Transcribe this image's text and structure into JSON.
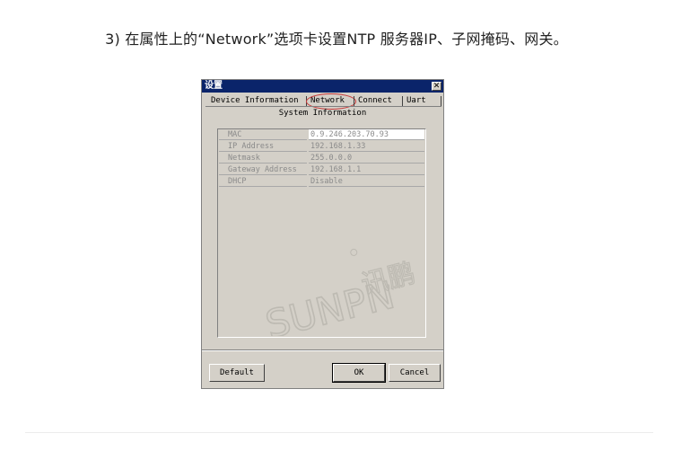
{
  "instruction": "3) 在属性上的“Network”选项卡设置NTP 服务器IP、子网掩码、网关。",
  "dialog": {
    "title": "设置",
    "close_label": "✕",
    "tabs": [
      {
        "label": "Device Information"
      },
      {
        "label": "Network"
      },
      {
        "label": "Connect"
      },
      {
        "label": "Uart"
      }
    ],
    "section_title": "System Information",
    "properties": [
      {
        "name": "MAC",
        "value": "0.9.246.203.70.93"
      },
      {
        "name": "IP Address",
        "value": "192.168.1.33"
      },
      {
        "name": "Netmask",
        "value": "255.0.0.0"
      },
      {
        "name": "Gateway Address",
        "value": "192.168.1.1"
      },
      {
        "name": "DHCP",
        "value": "Disable"
      }
    ],
    "watermark": {
      "latin": "SUNPN",
      "cjk": "讯鹏"
    },
    "buttons": {
      "default": "Default",
      "ok": "OK",
      "cancel": "Cancel"
    }
  },
  "colors": {
    "titlebar": "#0a246a",
    "dialog_bg": "#d4d0c8",
    "highlight": "#c83a3a"
  }
}
